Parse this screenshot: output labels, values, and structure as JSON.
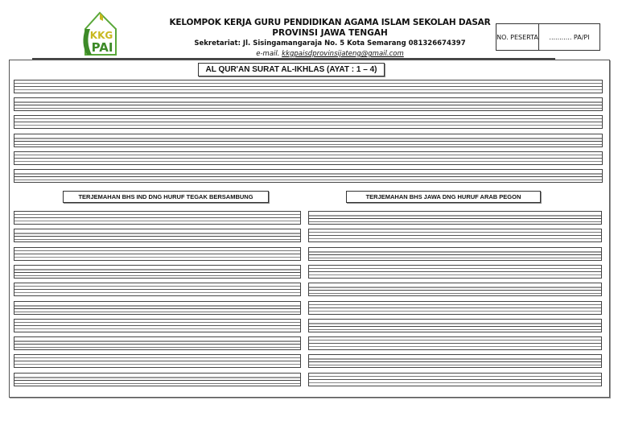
{
  "logo": {
    "line1": "KKG",
    "line2": "PAI"
  },
  "header": {
    "org": "KELOMPOK KERJA GURU PENDIDIKAN AGAMA ISLAM  SEKOLAH DASAR",
    "province": "PROVINSI JAWA TENGAH",
    "address": "Sekretariat: Jl. Sisingamangaraja No. 5 Kota Semarang 081326674397",
    "email_label": "e-mail.",
    "email": "kkgpaisdprovinsijateng@gmail.com"
  },
  "participant": {
    "label": "NO. PESERTA",
    "value": "........... PA/PI"
  },
  "worksheet": {
    "title": "AL QUR'AN SURAT AL-IKHLAS (AYAT : 1 – 4)",
    "left_column_title": "TERJEMAHAN BHS IND DNG HURUF TEGAK BERSAMBUNG",
    "right_column_title": "TERJEMAHAN BHS JAWA DNG HURUF ARAB PEGON",
    "top_writing_lines": 6,
    "column_writing_lines": 10
  },
  "colors": {
    "logo_green": "#4a9a2a",
    "logo_yellow": "#c8b820"
  }
}
